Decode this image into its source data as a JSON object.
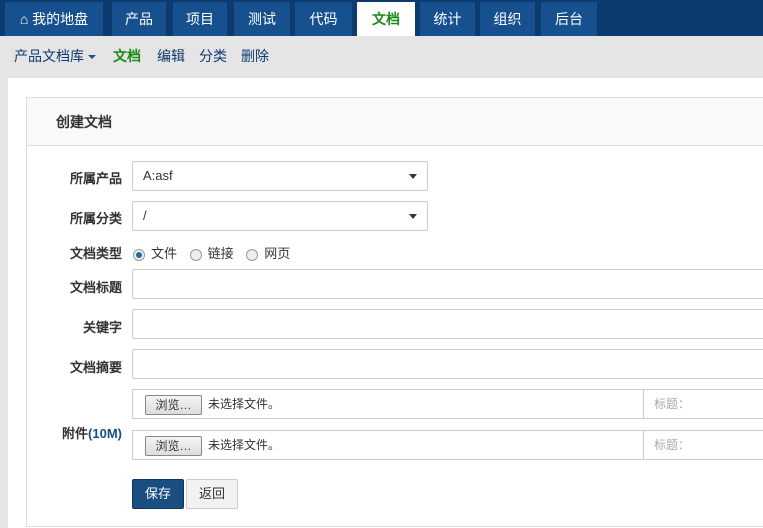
{
  "nav": {
    "tabs": [
      {
        "label": "我的地盘",
        "icon": "home-icon"
      },
      {
        "label": "产品"
      },
      {
        "label": "项目"
      },
      {
        "label": "测试"
      },
      {
        "label": "代码"
      },
      {
        "label": "文档",
        "active": true
      },
      {
        "label": "统计"
      },
      {
        "label": "组织"
      },
      {
        "label": "后台"
      }
    ]
  },
  "subnav": {
    "library": "产品文档库",
    "items": [
      "文档",
      "编辑",
      "分类",
      "删除"
    ]
  },
  "form": {
    "title": "创建文档",
    "product_label": "所属产品",
    "product_value": "A:asf",
    "category_label": "所属分类",
    "category_value": "/",
    "type_label": "文档类型",
    "types": [
      "文件",
      "链接",
      "网页"
    ],
    "title_label": "文档标题",
    "keywords_label": "关键字",
    "summary_label": "文档摘要",
    "attach_label": "附件",
    "attach_limit": "(10M)",
    "browse_label": "浏览…",
    "no_file": "未选择文件。",
    "file_title_placeholder": "标题：",
    "save": "保存",
    "back": "返回"
  },
  "colors": {
    "nav_bg": "#0d3a6f",
    "tab_bg": "#17508f",
    "active_green": "#1a8a1a",
    "primary": "#1a4d80"
  }
}
